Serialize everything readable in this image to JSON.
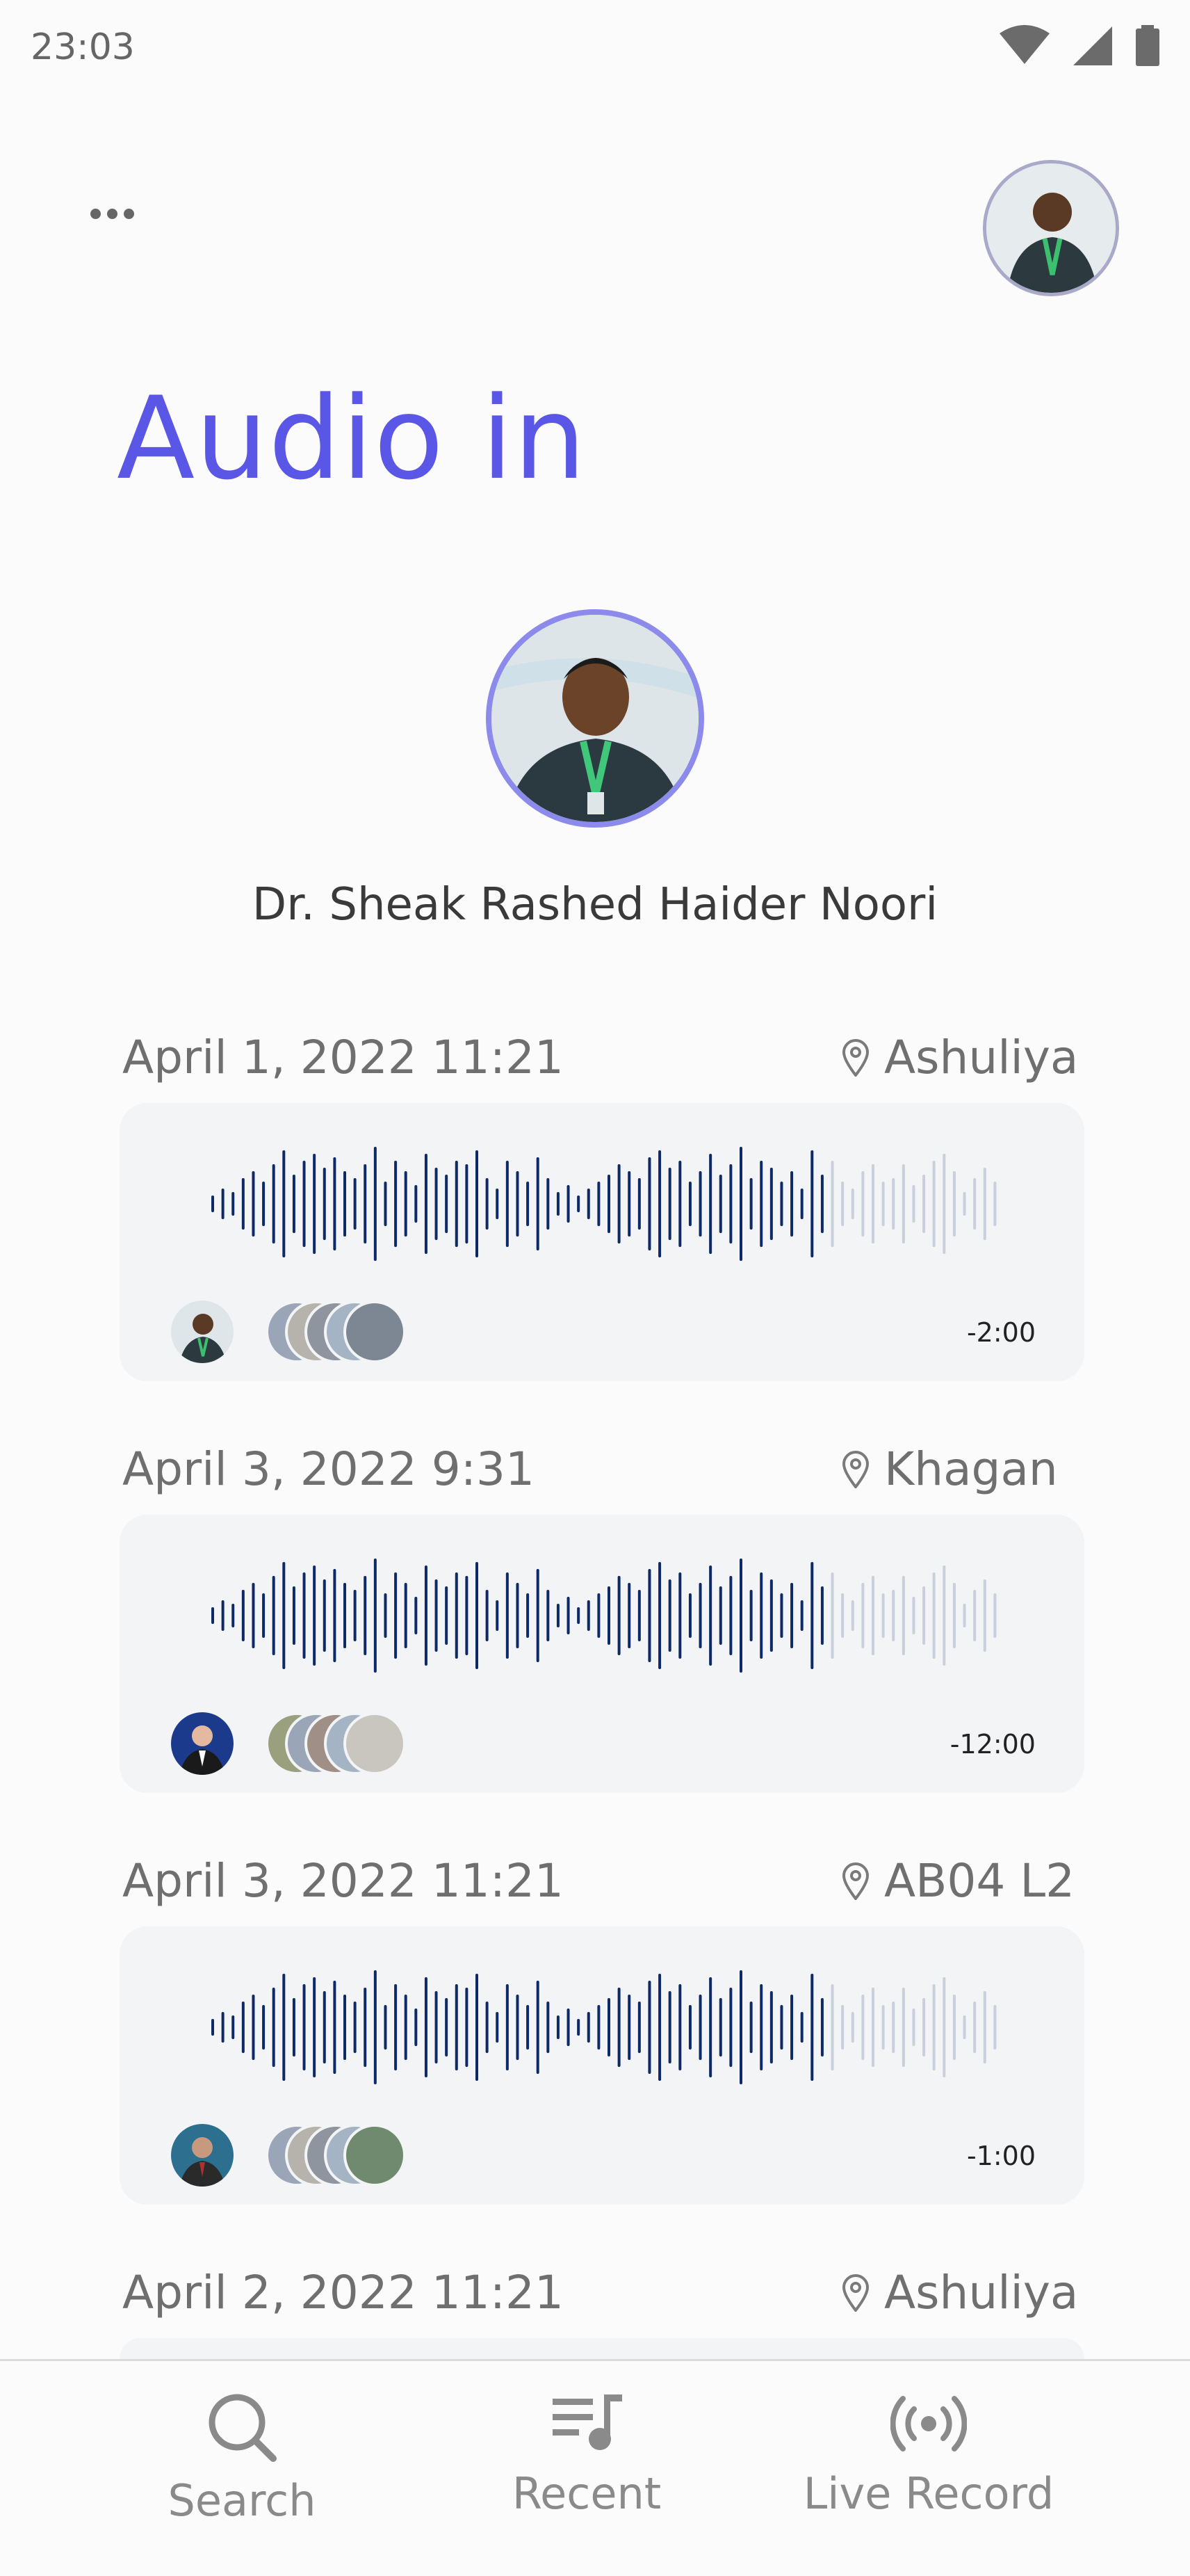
{
  "status_bar": {
    "time": "23:03"
  },
  "header": {
    "title": "Audio in",
    "more_icon": "more-horizontal-icon"
  },
  "profile": {
    "name": "Dr. Sheak Rashed Haider Noori"
  },
  "entries": [
    {
      "date": "April 1, 2022 11:21",
      "location": "Ashuliya",
      "duration": "-2:00"
    },
    {
      "date": "April 3, 2022 9:31",
      "location": "Khagan",
      "duration": "-12:00"
    },
    {
      "date": "April 3, 2022 11:21",
      "location": "AB04 L2",
      "duration": "-1:00"
    },
    {
      "date": "April 2, 2022 11:21",
      "location": "Ashuliya"
    }
  ],
  "nav": {
    "search": "Search",
    "recent": "Recent",
    "live_record": "Live Record"
  },
  "colors": {
    "accent": "#5b57e6",
    "wave_played": "#0d2a66",
    "wave_unplayed": "#c9cfdb"
  }
}
